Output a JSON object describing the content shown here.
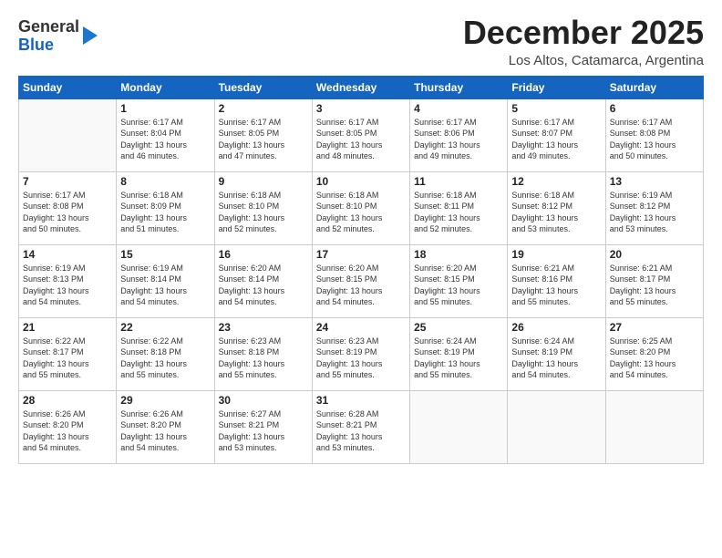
{
  "header": {
    "logo_line1": "General",
    "logo_line2": "Blue",
    "month": "December 2025",
    "location": "Los Altos, Catamarca, Argentina"
  },
  "weekdays": [
    "Sunday",
    "Monday",
    "Tuesday",
    "Wednesday",
    "Thursday",
    "Friday",
    "Saturday"
  ],
  "weeks": [
    [
      {
        "day": "",
        "info": ""
      },
      {
        "day": "1",
        "info": "Sunrise: 6:17 AM\nSunset: 8:04 PM\nDaylight: 13 hours\nand 46 minutes."
      },
      {
        "day": "2",
        "info": "Sunrise: 6:17 AM\nSunset: 8:05 PM\nDaylight: 13 hours\nand 47 minutes."
      },
      {
        "day": "3",
        "info": "Sunrise: 6:17 AM\nSunset: 8:05 PM\nDaylight: 13 hours\nand 48 minutes."
      },
      {
        "day": "4",
        "info": "Sunrise: 6:17 AM\nSunset: 8:06 PM\nDaylight: 13 hours\nand 49 minutes."
      },
      {
        "day": "5",
        "info": "Sunrise: 6:17 AM\nSunset: 8:07 PM\nDaylight: 13 hours\nand 49 minutes."
      },
      {
        "day": "6",
        "info": "Sunrise: 6:17 AM\nSunset: 8:08 PM\nDaylight: 13 hours\nand 50 minutes."
      }
    ],
    [
      {
        "day": "7",
        "info": "Sunrise: 6:17 AM\nSunset: 8:08 PM\nDaylight: 13 hours\nand 50 minutes."
      },
      {
        "day": "8",
        "info": "Sunrise: 6:18 AM\nSunset: 8:09 PM\nDaylight: 13 hours\nand 51 minutes."
      },
      {
        "day": "9",
        "info": "Sunrise: 6:18 AM\nSunset: 8:10 PM\nDaylight: 13 hours\nand 52 minutes."
      },
      {
        "day": "10",
        "info": "Sunrise: 6:18 AM\nSunset: 8:10 PM\nDaylight: 13 hours\nand 52 minutes."
      },
      {
        "day": "11",
        "info": "Sunrise: 6:18 AM\nSunset: 8:11 PM\nDaylight: 13 hours\nand 52 minutes."
      },
      {
        "day": "12",
        "info": "Sunrise: 6:18 AM\nSunset: 8:12 PM\nDaylight: 13 hours\nand 53 minutes."
      },
      {
        "day": "13",
        "info": "Sunrise: 6:19 AM\nSunset: 8:12 PM\nDaylight: 13 hours\nand 53 minutes."
      }
    ],
    [
      {
        "day": "14",
        "info": "Sunrise: 6:19 AM\nSunset: 8:13 PM\nDaylight: 13 hours\nand 54 minutes."
      },
      {
        "day": "15",
        "info": "Sunrise: 6:19 AM\nSunset: 8:14 PM\nDaylight: 13 hours\nand 54 minutes."
      },
      {
        "day": "16",
        "info": "Sunrise: 6:20 AM\nSunset: 8:14 PM\nDaylight: 13 hours\nand 54 minutes."
      },
      {
        "day": "17",
        "info": "Sunrise: 6:20 AM\nSunset: 8:15 PM\nDaylight: 13 hours\nand 54 minutes."
      },
      {
        "day": "18",
        "info": "Sunrise: 6:20 AM\nSunset: 8:15 PM\nDaylight: 13 hours\nand 55 minutes."
      },
      {
        "day": "19",
        "info": "Sunrise: 6:21 AM\nSunset: 8:16 PM\nDaylight: 13 hours\nand 55 minutes."
      },
      {
        "day": "20",
        "info": "Sunrise: 6:21 AM\nSunset: 8:17 PM\nDaylight: 13 hours\nand 55 minutes."
      }
    ],
    [
      {
        "day": "21",
        "info": "Sunrise: 6:22 AM\nSunset: 8:17 PM\nDaylight: 13 hours\nand 55 minutes."
      },
      {
        "day": "22",
        "info": "Sunrise: 6:22 AM\nSunset: 8:18 PM\nDaylight: 13 hours\nand 55 minutes."
      },
      {
        "day": "23",
        "info": "Sunrise: 6:23 AM\nSunset: 8:18 PM\nDaylight: 13 hours\nand 55 minutes."
      },
      {
        "day": "24",
        "info": "Sunrise: 6:23 AM\nSunset: 8:19 PM\nDaylight: 13 hours\nand 55 minutes."
      },
      {
        "day": "25",
        "info": "Sunrise: 6:24 AM\nSunset: 8:19 PM\nDaylight: 13 hours\nand 55 minutes."
      },
      {
        "day": "26",
        "info": "Sunrise: 6:24 AM\nSunset: 8:19 PM\nDaylight: 13 hours\nand 54 minutes."
      },
      {
        "day": "27",
        "info": "Sunrise: 6:25 AM\nSunset: 8:20 PM\nDaylight: 13 hours\nand 54 minutes."
      }
    ],
    [
      {
        "day": "28",
        "info": "Sunrise: 6:26 AM\nSunset: 8:20 PM\nDaylight: 13 hours\nand 54 minutes."
      },
      {
        "day": "29",
        "info": "Sunrise: 6:26 AM\nSunset: 8:20 PM\nDaylight: 13 hours\nand 54 minutes."
      },
      {
        "day": "30",
        "info": "Sunrise: 6:27 AM\nSunset: 8:21 PM\nDaylight: 13 hours\nand 53 minutes."
      },
      {
        "day": "31",
        "info": "Sunrise: 6:28 AM\nSunset: 8:21 PM\nDaylight: 13 hours\nand 53 minutes."
      },
      {
        "day": "",
        "info": ""
      },
      {
        "day": "",
        "info": ""
      },
      {
        "day": "",
        "info": ""
      }
    ]
  ]
}
